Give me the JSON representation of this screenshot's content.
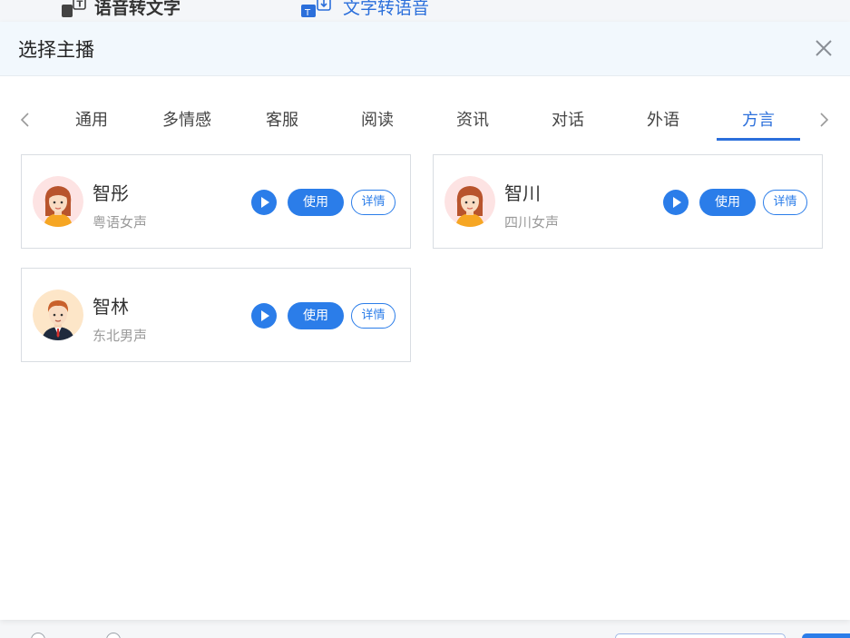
{
  "background": {
    "tab_speech_to_text": "语音转文字",
    "tab_text_to_speech": "文字转语音"
  },
  "dialog": {
    "title": "选择主播"
  },
  "tabs": [
    {
      "label": "通用"
    },
    {
      "label": "多情感"
    },
    {
      "label": "客服"
    },
    {
      "label": "阅读"
    },
    {
      "label": "资讯"
    },
    {
      "label": "对话"
    },
    {
      "label": "外语"
    },
    {
      "label": "方言",
      "active": true
    }
  ],
  "cards": [
    {
      "name": "智彤",
      "desc": "粤语女声",
      "avatar": "female-avatar-icon",
      "use_label": "使用",
      "detail_label": "详情"
    },
    {
      "name": "智川",
      "desc": "四川女声",
      "avatar": "female-avatar-icon",
      "use_label": "使用",
      "detail_label": "详情"
    },
    {
      "name": "智林",
      "desc": "东北男声",
      "avatar": "male-avatar-icon",
      "use_label": "使用",
      "detail_label": "详情"
    }
  ],
  "colors": {
    "accent": "#2b7de9",
    "active_tab": "#2b6fdb",
    "header_bg": "#f2f8fd"
  }
}
